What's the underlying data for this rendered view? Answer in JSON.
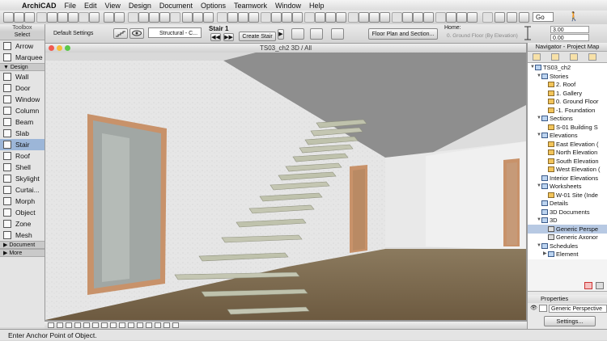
{
  "menubar": {
    "app_name": "ArchiCAD",
    "items": [
      "File",
      "Edit",
      "View",
      "Design",
      "Document",
      "Options",
      "Teamwork",
      "Window",
      "Help"
    ]
  },
  "toolbar": {
    "go_label": "Go",
    "zoom_value": ""
  },
  "infobox": {
    "default_settings": "Default Settings",
    "structural_select": "Structural - C...",
    "stair_title": "Stair 1",
    "create_stair": "Create Stair",
    "floor_plan_section": "Floor Plan and Section...",
    "home_label": "Home:",
    "home_value": "0. Ground Floor (By Elevation)",
    "value_top": "3.00",
    "value_bottom": "0.00"
  },
  "toolbox": {
    "title": "Toolbox",
    "select_label": "Select",
    "tools_top": [
      "Arrow",
      "Marquee"
    ],
    "design_section": "Design",
    "design_tools": [
      "Wall",
      "Door",
      "Window",
      "Column",
      "Beam",
      "Slab",
      "Stair",
      "Roof",
      "Shell",
      "Skylight",
      "Curtai...",
      "Morph",
      "Object",
      "Zone",
      "Mesh"
    ],
    "active_tool": "Stair",
    "document_section": "Document",
    "more_section": "More"
  },
  "viewport": {
    "title": "TS03_ch2 3D / All"
  },
  "navigator": {
    "title": "Navigator - Project Map",
    "tree": [
      {
        "label": "TS03_ch2",
        "level": 0,
        "arrow": "▼",
        "icon": "blue"
      },
      {
        "label": "Stories",
        "level": 1,
        "arrow": "▼",
        "icon": "blue"
      },
      {
        "label": "2. Roof",
        "level": 2,
        "arrow": "",
        "icon": "gold"
      },
      {
        "label": "1. Gallery",
        "level": 2,
        "arrow": "",
        "icon": "gold"
      },
      {
        "label": "0. Ground Floor",
        "level": 2,
        "arrow": "",
        "icon": "gold"
      },
      {
        "label": "-1. Foundation",
        "level": 2,
        "arrow": "",
        "icon": "gold"
      },
      {
        "label": "Sections",
        "level": 1,
        "arrow": "▼",
        "icon": "blue"
      },
      {
        "label": "S-01 Building S",
        "level": 2,
        "arrow": "",
        "icon": "gold"
      },
      {
        "label": "Elevations",
        "level": 1,
        "arrow": "▼",
        "icon": "blue"
      },
      {
        "label": "East Elevation (",
        "level": 2,
        "arrow": "",
        "icon": "gold"
      },
      {
        "label": "North Elevation",
        "level": 2,
        "arrow": "",
        "icon": "gold"
      },
      {
        "label": "South Elevation",
        "level": 2,
        "arrow": "",
        "icon": "gold"
      },
      {
        "label": "West Elevation (",
        "level": 2,
        "arrow": "",
        "icon": "gold"
      },
      {
        "label": "Interior Elevations",
        "level": 1,
        "arrow": "",
        "icon": "blue"
      },
      {
        "label": "Worksheets",
        "level": 1,
        "arrow": "▼",
        "icon": "blue"
      },
      {
        "label": "W-01 Site (Inde",
        "level": 2,
        "arrow": "",
        "icon": "gold"
      },
      {
        "label": "Details",
        "level": 1,
        "arrow": "",
        "icon": "blue"
      },
      {
        "label": "3D Documents",
        "level": 1,
        "arrow": "",
        "icon": "blue"
      },
      {
        "label": "3D",
        "level": 1,
        "arrow": "▼",
        "icon": "blue"
      },
      {
        "label": "Generic Perspe",
        "level": 2,
        "arrow": "",
        "icon": "gray",
        "selected": true
      },
      {
        "label": "Generic Axonor",
        "level": 2,
        "arrow": "",
        "icon": "gray"
      },
      {
        "label": "Schedules",
        "level": 1,
        "arrow": "▼",
        "icon": "blue"
      },
      {
        "label": "Element",
        "level": 2,
        "arrow": "▶",
        "icon": "blue"
      }
    ]
  },
  "properties": {
    "title": "Properties",
    "value": "Generic Perspective",
    "settings_button": "Settings..."
  },
  "status_bar": {
    "text": "Enter Anchor Point of Object."
  }
}
